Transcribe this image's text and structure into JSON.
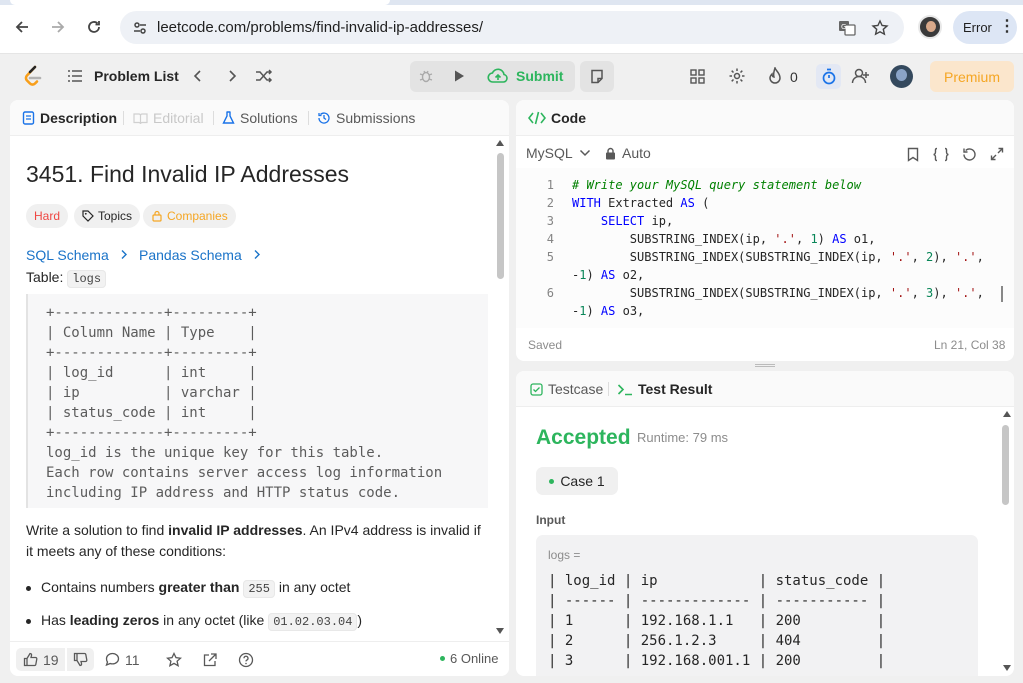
{
  "browser": {
    "url": "leetcode.com/problems/find-invalid-ip-addresses/",
    "error_label": "Error"
  },
  "header": {
    "problem_list_label": "Problem List",
    "submit_label": "Submit",
    "fire_count": "0",
    "premium_label": "Premium"
  },
  "left_tabs": [
    {
      "label": "Description"
    },
    {
      "label": "Editorial"
    },
    {
      "label": "Solutions"
    },
    {
      "label": "Submissions"
    }
  ],
  "problem": {
    "title": "3451. Find Invalid IP Addresses",
    "difficulty": "Hard",
    "topics_label": "Topics",
    "companies_label": "Companies",
    "sql_schema_label": "SQL Schema",
    "pandas_schema_label": "Pandas Schema",
    "table_prefix": "Table:",
    "table_name": "logs",
    "schema_text": "+-------------+---------+\n| Column Name | Type    |\n+-------------+---------+\n| log_id      | int     |\n| ip          | varchar |\n| status_code | int     |\n+-------------+---------+\nlog_id is the unique key for this table.\nEach row contains server access log information\nincluding IP address and HTTP status code.",
    "desc_part1": "Write a solution to find ",
    "desc_bold": "invalid IP addresses",
    "desc_part2": ". An IPv4 address is invalid if it meets any of these conditions:",
    "bullet1_pre": "Contains numbers ",
    "bullet1_bold": "greater than",
    "bullet1_code": "255",
    "bullet1_post": " in any octet",
    "bullet2_pre": "Has ",
    "bullet2_bold": "leading zeros",
    "bullet2_mid": " in any octet (like ",
    "bullet2_code": "01.02.03.04",
    "bullet2_post": ")"
  },
  "footer": {
    "likes": "19",
    "comments": "11",
    "online": "6 Online"
  },
  "code": {
    "title": "Code",
    "language": "MySQL",
    "mode": "Auto",
    "saved": "Saved",
    "cursor": "Ln 21, Col 38",
    "lines": [
      {
        "n": "1",
        "text": "# Write your MySQL query statement below"
      },
      {
        "n": "2",
        "text": "WITH Extracted AS ("
      },
      {
        "n": "3",
        "text": "    SELECT ip,"
      },
      {
        "n": "4",
        "text": "        SUBSTRING_INDEX(ip, '.', 1) AS o1,"
      },
      {
        "n": "5",
        "text": "        SUBSTRING_INDEX(SUBSTRING_INDEX(ip, '.', 2), '.',"
      },
      {
        "n": "",
        "text": "-1) AS o2,"
      },
      {
        "n": "6",
        "text": "        SUBSTRING_INDEX(SUBSTRING_INDEX(ip, '.', 3), '.',"
      },
      {
        "n": "",
        "text": "-1) AS o3,"
      }
    ]
  },
  "result": {
    "testcase_tab": "Testcase",
    "result_tab": "Test Result",
    "status": "Accepted",
    "runtime": "Runtime: 79 ms",
    "case_label": "Case 1",
    "input_label": "Input",
    "logs_label": "logs =",
    "logs_table": "| log_id | ip            | status_code |\n| ------ | ------------- | ----------- |\n| 1      | 192.168.1.1   | 200         |\n| 2      | 256.1.2.3     | 404         |\n| 3      | 192.168.001.1 | 200         |"
  },
  "colors": {
    "accepted": "#2db55d",
    "hard": "#ef4743",
    "link": "#1a73c8",
    "premium": "#f5a623"
  }
}
